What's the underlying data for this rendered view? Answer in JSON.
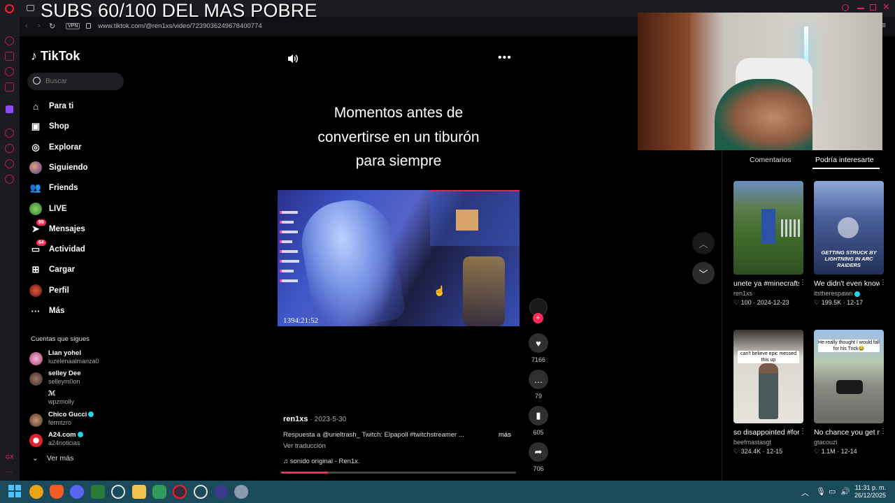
{
  "stream_overlay": {
    "title": "SUBS 60/100 DEL MAS POBRE"
  },
  "browser": {
    "url": "www.tiktok.com/@ren1xs/video/7239036249678400774",
    "vpn_label": "VPN"
  },
  "sidebar": {
    "logo": "TikTok",
    "search_placeholder": "Buscar",
    "nav": [
      {
        "label": "Para ti",
        "icon": "home-icon"
      },
      {
        "label": "Shop",
        "icon": "shop-icon"
      },
      {
        "label": "Explorar",
        "icon": "compass-icon"
      },
      {
        "label": "Siguiendo",
        "icon": "following-avatar-icon"
      },
      {
        "label": "Friends",
        "icon": "friends-icon"
      },
      {
        "label": "LIVE",
        "icon": "live-icon"
      },
      {
        "label": "Mensajes",
        "icon": "messages-icon",
        "badge": "99"
      },
      {
        "label": "Actividad",
        "icon": "activity-icon",
        "badge": "64"
      },
      {
        "label": "Cargar",
        "icon": "upload-icon"
      },
      {
        "label": "Perfil",
        "icon": "profile-icon"
      },
      {
        "label": "Más",
        "icon": "more-dots-icon"
      }
    ],
    "following_heading": "Cuentas que sigues",
    "following": [
      {
        "name": "Lian yohel",
        "username": "luzelenaalmanza0",
        "verified": false
      },
      {
        "name": "selley Dee",
        "username": "selleym0on",
        "verified": false
      },
      {
        "name": "ℳ",
        "username": "wpzmolly",
        "verified": false
      },
      {
        "name": "Chico Gucci",
        "username": "fermtzro",
        "verified": true
      },
      {
        "name": "A24.com",
        "username": "a24noticias",
        "verified": true
      }
    ],
    "see_more": "Ver más"
  },
  "video": {
    "caption_lines": [
      "Momentos antes de",
      "convertirse en un tiburón",
      "para siempre"
    ],
    "clip_timestamp": "1394:21:52",
    "author": "ren1xs",
    "date": "2023-5-30",
    "description": "Respuesta a @urieltrash_ Twitch: Elpapoll #twitchstreamer ...",
    "more_label": "más",
    "translate_label": "Ver traducción",
    "sound": "sonido original - Ren1x.",
    "progress": 0.2,
    "likes": "7166",
    "comments": "79",
    "saves": "605",
    "shares": "706"
  },
  "right_panel": {
    "tabs": [
      "Comentarios",
      "Podría interesarte"
    ],
    "active_tab": 1,
    "cards": [
      {
        "title": "unete ya #minecraftservid...",
        "author": "ren1xs",
        "likes": "100",
        "date": "2024-12-23",
        "verified": false
      },
      {
        "title": "We didn't even know this was a...",
        "author": "itstherespawn",
        "likes": "199.5K",
        "date": "12-17",
        "verified": true,
        "overlay": "GETTING STRUCK BY LIGHTNING IN ARC RAIDERS"
      },
      {
        "title": "so disappointed #fortnite #kimk...",
        "author": "beefmastasgt",
        "likes": "324.4K",
        "date": "12-15",
        "verified": false,
        "overlay": "can't believe epic messed this up"
      },
      {
        "title": "No chance you get me with this Bro...",
        "author": "gtacouzi",
        "likes": "1.1M",
        "date": "12-14",
        "verified": false,
        "overlay": "He really thought I would fall for his Trick😂"
      }
    ]
  },
  "taskbar": {
    "time": "11:31 p. m.",
    "date": "26/12/2025"
  },
  "colors": {
    "accent": "#fe2c55",
    "verified": "#20d5ec",
    "taskbar": "#1b4a5a"
  }
}
